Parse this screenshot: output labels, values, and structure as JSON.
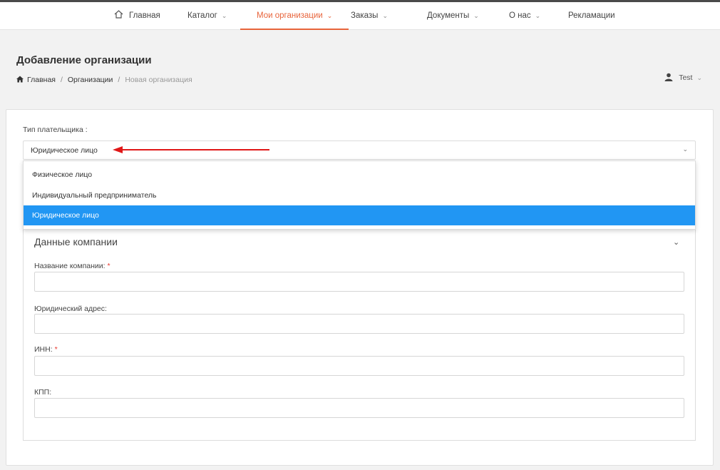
{
  "nav": {
    "home": "Главная",
    "catalog": "Каталог",
    "my_orgs": "Мои организации",
    "orders": "Заказы",
    "documents": "Документы",
    "about": "О нас",
    "claims": "Рекламации",
    "chevron": "⌄",
    "active_color": "#e8633a"
  },
  "header": {
    "title": "Добавление организации",
    "breadcrumb": {
      "home": "Главная",
      "orgs": "Организации",
      "current": "Новая организация",
      "separator": "/"
    }
  },
  "user": {
    "name": "Test",
    "icon": "user-icon"
  },
  "payer": {
    "label": "Тип плательщика :",
    "selected": "Юридическое лицо",
    "options": [
      "Физическое лицо",
      "Индивидуальный предприниматель",
      "Юридическое лицо"
    ],
    "highlight_color": "#2196f3"
  },
  "company": {
    "title": "Данные компании",
    "fields": [
      {
        "label": "Название компании:",
        "required": "*",
        "value": ""
      },
      {
        "label": "Юридический адрес:",
        "required": "",
        "value": ""
      },
      {
        "label": "ИНН:",
        "required": "*",
        "value": ""
      },
      {
        "label": "КПП:",
        "required": "",
        "value": ""
      }
    ]
  }
}
